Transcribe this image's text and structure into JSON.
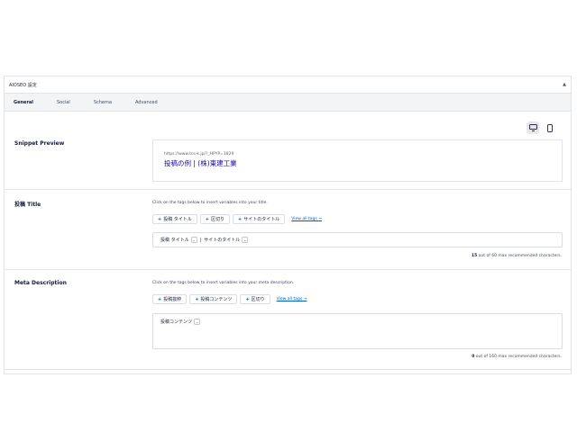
{
  "panel": {
    "title": "AIOSEO 設定",
    "caret": "▲"
  },
  "tabs": [
    {
      "label": "General"
    },
    {
      "label": "Social"
    },
    {
      "label": "Schema"
    },
    {
      "label": "Advanced"
    }
  ],
  "device_toggle": {
    "desktop_icon": "desktop-icon",
    "mobile_icon": "mobile-icon"
  },
  "snippet": {
    "label": "Snippet Preview",
    "url": "https://www.tcs-k.jp/?_HPYP=1829",
    "title": "投稿の例 | (株)東建工業"
  },
  "post_title": {
    "label": "投稿 Title",
    "hint": "Click on the tags below to insert variables into your title.",
    "tags": [
      "投稿 タイトル",
      "区切り",
      "サイトのタイトル"
    ],
    "view_all": "View all tags →",
    "chips": [
      "投稿 タイトル",
      "|",
      "サイトのタイトル"
    ],
    "count": "15",
    "count_suffix": " out of 60 max recommended characters."
  },
  "meta": {
    "label": "Meta Description",
    "hint": "Click on the tags below to insert variables into your meta description.",
    "tags": [
      "投稿抜粋",
      "投稿コンテンツ",
      "区切り"
    ],
    "view_all": "View all tags →",
    "chips": [
      "投稿コンテンツ"
    ],
    "count": "0",
    "count_suffix": " out of 160 max recommended characters."
  },
  "colors": {
    "accent": "#005ae0",
    "link_title": "#1a0dab",
    "border": "#e4e4e8"
  }
}
